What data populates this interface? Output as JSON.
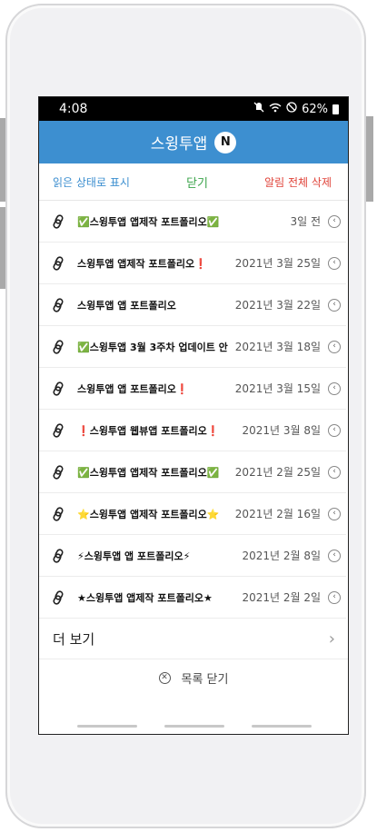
{
  "status": {
    "time": "4:08",
    "battery": "62%"
  },
  "header": {
    "title": "스윙투앱",
    "badge": "N"
  },
  "actions": {
    "read": "읽은 상태로 표시",
    "close": "닫기",
    "delete_all": "알림 전체 삭제"
  },
  "items": [
    {
      "title": "✅스윙투앱 앱제작 포트폴리오✅",
      "date": "3일 전"
    },
    {
      "title": "스윙투앱 앱제작 포트폴리오❗",
      "date": "2021년 3월 25일"
    },
    {
      "title": "스윙투앱 앱 포트폴리오",
      "date": "2021년 3월 22일"
    },
    {
      "title": "✅스윙투앱 3월 3주차 업데이트 안",
      "date": "2021년 3월 18일"
    },
    {
      "title": "스윙투앱 앱 포트폴리오❗",
      "date": "2021년 3월 15일"
    },
    {
      "title": "❗스윙투앱 웹뷰앱 포트폴리오❗",
      "date": "2021년 3월 8일"
    },
    {
      "title": "✅스윙투앱 앱제작 포트폴리오✅",
      "date": "2021년 2월 25일"
    },
    {
      "title": "⭐스윙투앱 앱제작 포트폴리오⭐",
      "date": "2021년 2월 16일"
    },
    {
      "title": "⚡스윙투앱 앱 포트폴리오⚡",
      "date": "2021년 2월 8일"
    },
    {
      "title": "★스윙투앱 앱제작 포트폴리오★",
      "date": "2021년 2월 2일"
    }
  ],
  "more": {
    "label": "더 보기"
  },
  "footer": {
    "close_list": "목록 닫기"
  },
  "colors": {
    "appbar": "#3d8fd0",
    "read": "#3d8fd0",
    "close": "#3aa34a",
    "delete": "#e0443a"
  }
}
